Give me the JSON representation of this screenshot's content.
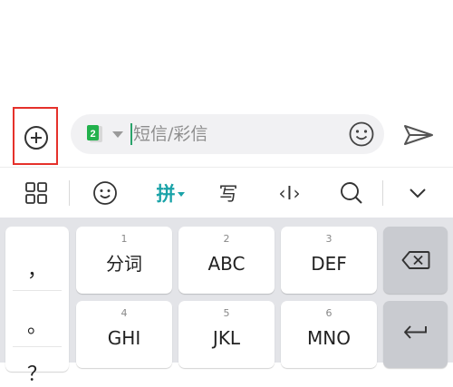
{
  "compose": {
    "attach_icon": "plus-circle-icon",
    "sim_badge": "2",
    "placeholder": "短信/彩信",
    "emoji_icon": "smiley-icon",
    "send_icon": "send-icon"
  },
  "toolbar": {
    "apps_icon": "grid-icon",
    "emoji_icon": "smiley-icon",
    "pinyin_label": "拼",
    "write_label": "写",
    "cursor_label": "‹I›",
    "search_icon": "search-icon",
    "collapse_icon": "chevron-down-icon",
    "accent_color": "#1aa3a8"
  },
  "keyboard": {
    "symbols": [
      "，",
      "。",
      "？"
    ],
    "row1": [
      {
        "num": "1",
        "label": "分词"
      },
      {
        "num": "2",
        "label": "ABC"
      },
      {
        "num": "3",
        "label": "DEF"
      }
    ],
    "row2": [
      {
        "num": "4",
        "label": "GHI"
      },
      {
        "num": "5",
        "label": "JKL"
      },
      {
        "num": "6",
        "label": "MNO"
      }
    ],
    "backspace_icon": "backspace-icon",
    "enter_icon": "enter-icon"
  }
}
